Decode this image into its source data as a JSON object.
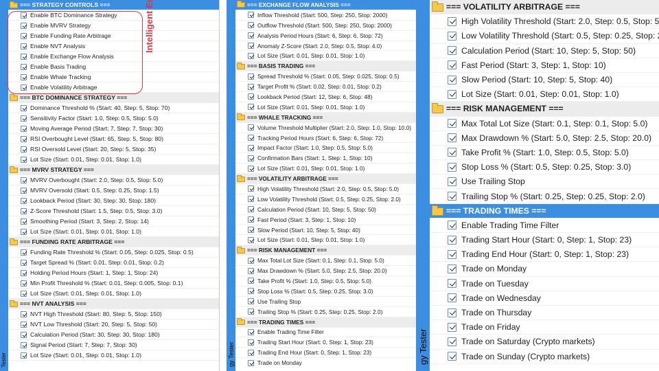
{
  "annotation": {
    "text": "Intelligent Engine",
    "color": "#e03545"
  },
  "colors": {
    "accent": "#3c8ee0",
    "section_bg": "#ececec",
    "folder": "#f3c94b"
  },
  "panels": [
    {
      "side_label": "Tester",
      "rows": [
        {
          "type": "section",
          "label": "=== STRATEGY CONTROLS ===",
          "selected": true
        },
        {
          "type": "check",
          "label": "Enable BTC Dominance Strategy"
        },
        {
          "type": "check",
          "label": "Enable MVRV Strategy"
        },
        {
          "type": "check",
          "label": "Enable Funding Rate Arbitrage"
        },
        {
          "type": "check",
          "label": "Enable NVT Analysis"
        },
        {
          "type": "check",
          "label": "Enable Exchange Flow Analysis"
        },
        {
          "type": "check",
          "label": "Enable Basis Trading"
        },
        {
          "type": "check",
          "label": "Enable Whale Tracking"
        },
        {
          "type": "check",
          "label": "Enable Volatility Arbitrage"
        },
        {
          "type": "section",
          "label": "=== BTC DOMINANCE STRATEGY ==="
        },
        {
          "type": "check",
          "label": "Dominance Threshold % (Start: 40, Step: 5, Stop: 70)"
        },
        {
          "type": "check",
          "label": "Sensitivity Factor (Start: 1.0, Step: 0.5, Stop: 5.0)"
        },
        {
          "type": "check",
          "label": "Moving Average Period (Start: 7, Step: 7, Stop: 30)"
        },
        {
          "type": "check",
          "label": "RSI Overbought Level (Start: 65, Step: 5, Stop: 80)"
        },
        {
          "type": "check",
          "label": "RSI Oversold Level (Start: 20, Step: 5, Stop: 35)"
        },
        {
          "type": "check",
          "label": "Lot Size (Start: 0.01, Step: 0.01, Stop: 1.0)"
        },
        {
          "type": "section",
          "label": "=== MVRV STRATEGY ==="
        },
        {
          "type": "check",
          "label": "MVRV Overbought (Start: 2.0, Step: 0.5, Stop: 5.0)"
        },
        {
          "type": "check",
          "label": "MVRV Oversold (Start: 0.5, Step: 0.25, Stop: 1.5)"
        },
        {
          "type": "check",
          "label": "Lookback Period (Start: 30, Step: 30, Stop: 180)"
        },
        {
          "type": "check",
          "label": "Z-Score Threshold (Start: 1.5, Step: 0.5, Stop: 3.0)"
        },
        {
          "type": "check",
          "label": "Smoothing Period (Start: 3, Step: 2, Stop: 14)"
        },
        {
          "type": "check",
          "label": "Lot Size (Start: 0.01, Step: 0.01, Stop: 1.0)"
        },
        {
          "type": "section",
          "label": "=== FUNDING RATE ARBITRAGE ==="
        },
        {
          "type": "check",
          "label": "Funding Rate Threshold % (Start: 0.05, Step: 0.025, Stop: 0.5)"
        },
        {
          "type": "check",
          "label": "Target Spread % (Start: 0.01, Step: 0.01, Stop: 0.2)"
        },
        {
          "type": "check",
          "label": "Holding Period Hours (Start: 1, Step: 1, Stop: 24)"
        },
        {
          "type": "check",
          "label": "Min Profit Threshold % (Start: 0.01, Step: 0.005, Stop: 0.1)"
        },
        {
          "type": "check",
          "label": "Lot Size (Start: 0.01, Step: 0.01, Stop: 1.0)"
        },
        {
          "type": "section",
          "label": "=== NVT ANALYSIS ==="
        },
        {
          "type": "check",
          "label": "NVT High Threshold (Start: 80, Step: 5, Stop: 150)"
        },
        {
          "type": "check",
          "label": "NVT Low Threshold (Start: 20, Step: 5, Stop: 50)"
        },
        {
          "type": "check",
          "label": "Calculation Period (Start: 30, Step: 30, Stop: 180)"
        },
        {
          "type": "check",
          "label": "Signal Period (Start: 7, Step: 7, Stop: 30)"
        },
        {
          "type": "check",
          "label": "Lot Size (Start: 0.01, Step: 0.01, Stop: 1.0)"
        }
      ]
    },
    {
      "side_label": "gy Tester",
      "rows": [
        {
          "type": "section",
          "label": "=== EXCHANGE FLOW ANALYSIS ===",
          "selected": true
        },
        {
          "type": "check",
          "label": "Inflow Threshold (Start: 500, Step: 250, Stop: 2000)"
        },
        {
          "type": "check",
          "label": "Outflow Threshold (Start: 500, Step: 250, Stop: 2000)"
        },
        {
          "type": "check",
          "label": "Analysis Period Hours (Start: 6, Step: 6, Stop: 72)"
        },
        {
          "type": "check",
          "label": "Anomaly Z-Score (Start: 2.0, Step: 0.5, Stop: 4.0)"
        },
        {
          "type": "check",
          "label": "Lot Size (Start: 0.01, Step: 0.01, Stop: 1.0)"
        },
        {
          "type": "section",
          "label": "=== BASIS TRADING ==="
        },
        {
          "type": "check",
          "label": "Spread Threshold % (Start: 0.05, Step: 0.025, Stop: 0.5)"
        },
        {
          "type": "check",
          "label": "Target Profit % (Start: 0.02, Step: 0.01, Stop: 0.2)"
        },
        {
          "type": "check",
          "label": "Lookback Period (Start: 12, Step: 6, Stop: 48)"
        },
        {
          "type": "check",
          "label": "Lot Size (Start: 0.01, Step: 0.01, Stop: 1.0)"
        },
        {
          "type": "section",
          "label": "=== WHALE TRACKING ==="
        },
        {
          "type": "check",
          "label": "Volume Threshold Multiplier (Start: 2.0, Step: 1.0, Stop: 10.0)"
        },
        {
          "type": "check",
          "label": "Tracking Period Hours (Start: 6, Step: 6, Stop: 72)"
        },
        {
          "type": "check",
          "label": "Impact Factor (Start: 1.0, Step: 0.5, Stop: 5.0)"
        },
        {
          "type": "check",
          "label": "Confirmation Bars (Start: 1, Step: 1, Stop: 10)"
        },
        {
          "type": "check",
          "label": "Lot Size (Start: 0.01, Step: 0.01, Stop: 1.0)"
        },
        {
          "type": "section",
          "label": "=== VOLATILITY ARBITRAGE ==="
        },
        {
          "type": "check",
          "label": "High Volatility Threshold (Start: 2.0, Step: 0.5, Stop: 5.0)"
        },
        {
          "type": "check",
          "label": "Low Volatility Threshold (Start: 0.5, Step: 0.25, Stop: 2.0)"
        },
        {
          "type": "check",
          "label": "Calculation Period (Start: 10, Step: 5, Stop: 50)"
        },
        {
          "type": "check",
          "label": "Fast Period (Start: 3, Step: 1, Stop: 10)"
        },
        {
          "type": "check",
          "label": "Slow Period (Start: 10, Step: 5, Stop: 40)"
        },
        {
          "type": "check",
          "label": "Lot Size (Start: 0.01, Step: 0.01, Stop: 1.0)"
        },
        {
          "type": "section",
          "label": "=== RISK MANAGEMENT ==="
        },
        {
          "type": "check",
          "label": "Max Total Lot Size (Start: 0.1, Step: 0.1, Stop: 5.0)"
        },
        {
          "type": "check",
          "label": "Max Drawdown % (Start: 5.0, Step: 2.5, Stop: 20.0)"
        },
        {
          "type": "check",
          "label": "Take Profit % (Start: 1.0, Step: 0.5, Stop: 5.0)"
        },
        {
          "type": "check",
          "label": "Stop Loss % (Start: 0.5, Step: 0.25, Stop: 3.0)"
        },
        {
          "type": "check",
          "label": "Use Trailing Stop"
        },
        {
          "type": "check",
          "label": "Trailing Stop % (Start: 0.25, Step: 0.25, Stop: 2.0)"
        },
        {
          "type": "section",
          "label": "=== TRADING TIMES ==="
        },
        {
          "type": "check",
          "label": "Enable Trading Time Filter"
        },
        {
          "type": "check",
          "label": "Trading Start Hour (Start: 0, Step: 1, Stop: 23)"
        },
        {
          "type": "check",
          "label": "Trading End Hour (Start: 0, Step: 1, Stop: 23)"
        },
        {
          "type": "check",
          "label": "Trade on Monday",
          "partial": true
        }
      ]
    },
    {
      "side_label": "gy Tester",
      "rows": [
        {
          "type": "section",
          "label": "=== VOLATILITY ARBITRAGE ==="
        },
        {
          "type": "check",
          "label": "High Volatility Threshold (Start: 2.0, Step: 0.5, Stop: 5.0)"
        },
        {
          "type": "check",
          "label": "Low Volatility Threshold (Start: 0.5, Step: 0.25, Stop: 2.0)"
        },
        {
          "type": "check",
          "label": "Calculation Period (Start: 10, Step: 5, Stop: 50)"
        },
        {
          "type": "check",
          "label": "Fast Period (Start: 3, Step: 1, Stop: 10)"
        },
        {
          "type": "check",
          "label": "Slow Period (Start: 10, Step: 5, Stop: 40)"
        },
        {
          "type": "check",
          "label": "Lot Size (Start: 0.01, Step: 0.01, Stop: 1.0)"
        },
        {
          "type": "section",
          "label": "=== RISK MANAGEMENT ==="
        },
        {
          "type": "check",
          "label": "Max Total Lot Size (Start: 0.1, Step: 0.1, Stop: 5.0)"
        },
        {
          "type": "check",
          "label": "Max Drawdown % (Start: 5.0, Step: 2.5, Stop: 20.0)"
        },
        {
          "type": "check",
          "label": "Take Profit % (Start: 1.0, Step: 0.5, Stop: 5.0)"
        },
        {
          "type": "check",
          "label": "Stop Loss % (Start: 0.5, Step: 0.25, Stop: 3.0)"
        },
        {
          "type": "check",
          "label": "Use Trailing Stop"
        },
        {
          "type": "check",
          "label": "Trailing Stop % (Start: 0.25, Step: 0.25, Stop: 2.0)"
        },
        {
          "type": "section",
          "label": "=== TRADING TIMES ===",
          "selected": true
        },
        {
          "type": "check",
          "label": "Enable Trading Time Filter"
        },
        {
          "type": "check",
          "label": "Trading Start Hour (Start: 0, Step: 1, Stop: 23)"
        },
        {
          "type": "check",
          "label": "Trading End Hour (Start: 0, Step: 1, Stop: 23)"
        },
        {
          "type": "check",
          "label": "Trade on Monday"
        },
        {
          "type": "check",
          "label": "Trade on Tuesday"
        },
        {
          "type": "check",
          "label": "Trade on Wednesday"
        },
        {
          "type": "check",
          "label": "Trade on Thursday"
        },
        {
          "type": "check",
          "label": "Trade on Friday"
        },
        {
          "type": "check",
          "label": "Trade on Saturday (Crypto markets)"
        },
        {
          "type": "check",
          "label": "Trade on Sunday (Crypto markets)"
        }
      ]
    }
  ]
}
